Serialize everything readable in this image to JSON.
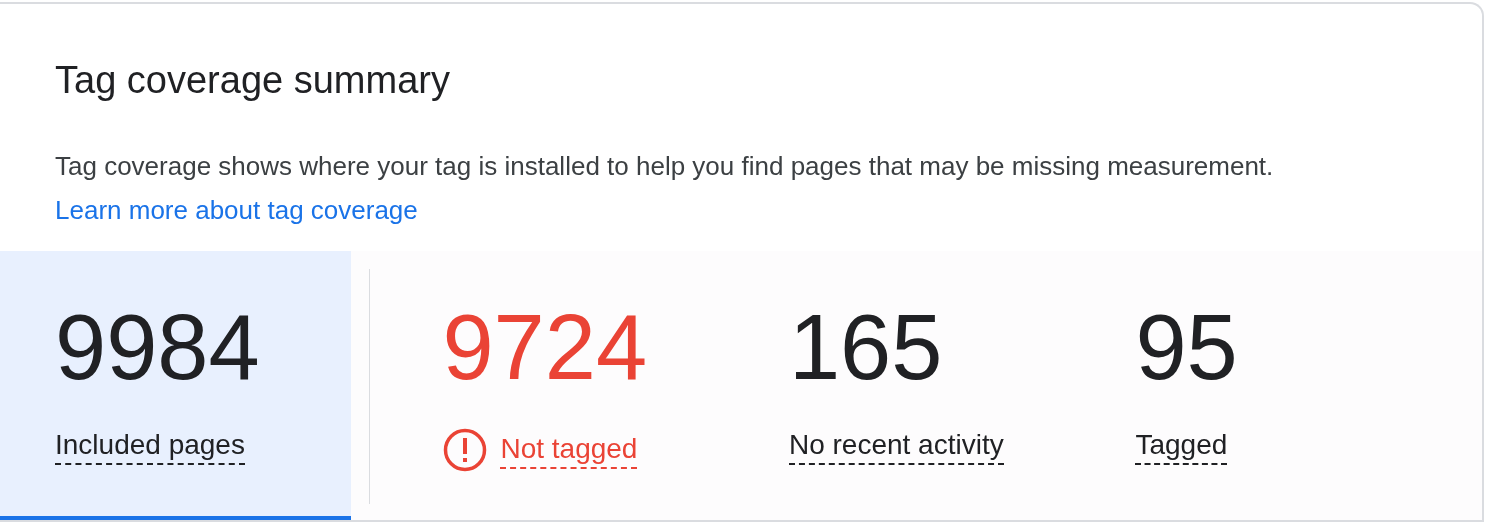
{
  "card": {
    "title": "Tag coverage summary",
    "description": "Tag coverage shows where your tag is installed to help you find pages that may be missing measurement.",
    "link": "Learn more about tag coverage"
  },
  "tabs": [
    {
      "value": "9984",
      "label": "Included pages",
      "kind": "plain",
      "selected": true
    },
    {
      "value": "9724",
      "label": "Not tagged",
      "kind": "error",
      "selected": false
    },
    {
      "value": "165",
      "label": "No recent activity",
      "kind": "plain",
      "selected": false
    },
    {
      "value": "95",
      "label": "Tagged",
      "kind": "plain",
      "selected": false
    }
  ]
}
